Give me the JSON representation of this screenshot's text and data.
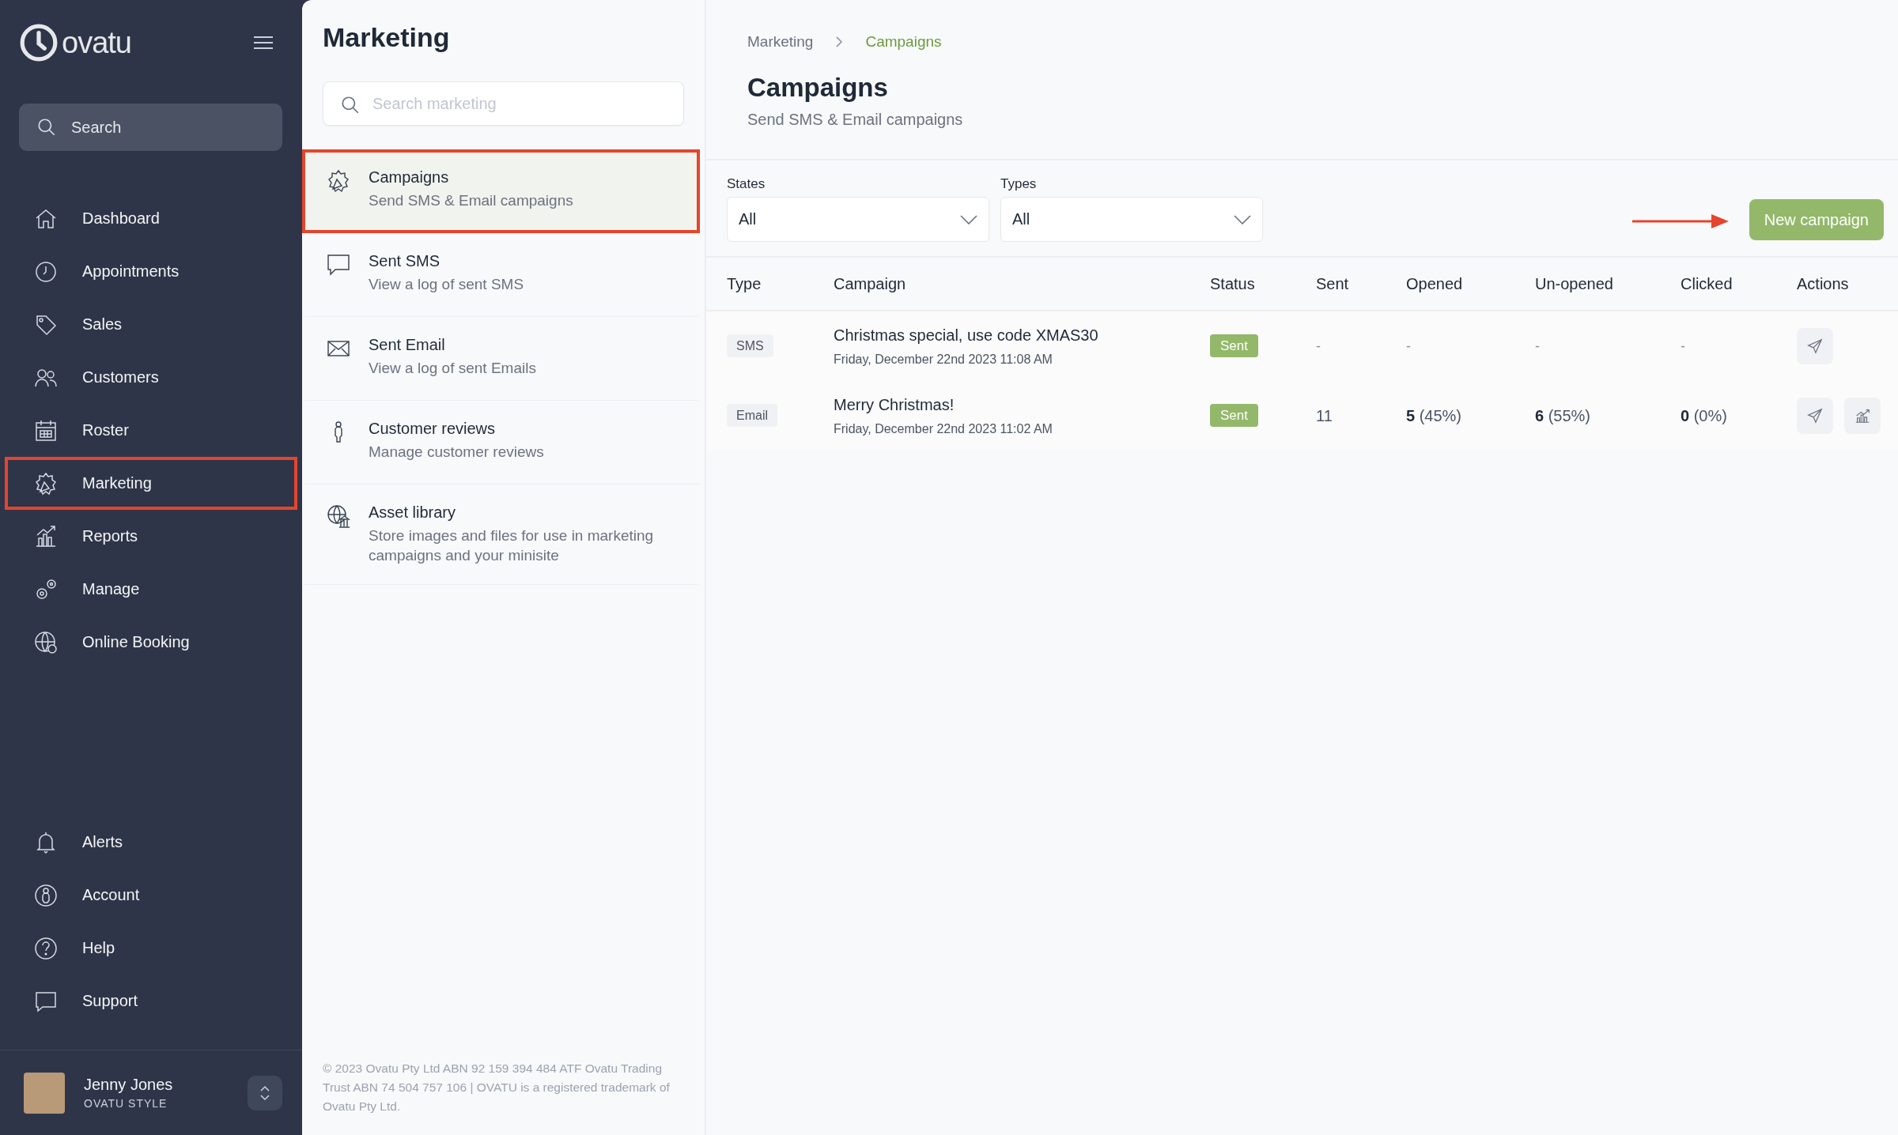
{
  "sidebar": {
    "logo": "ovatu",
    "search_placeholder": "Search",
    "nav_items": [
      {
        "label": "Dashboard",
        "highlighted": false
      },
      {
        "label": "Appointments",
        "highlighted": false
      },
      {
        "label": "Sales",
        "highlighted": false
      },
      {
        "label": "Customers",
        "highlighted": false
      },
      {
        "label": "Roster",
        "highlighted": false
      },
      {
        "label": "Marketing",
        "highlighted": true
      },
      {
        "label": "Reports",
        "highlighted": false
      },
      {
        "label": "Manage",
        "highlighted": false
      },
      {
        "label": "Online Booking",
        "highlighted": false
      }
    ],
    "bottom_items": [
      {
        "label": "Alerts"
      },
      {
        "label": "Account"
      },
      {
        "label": "Help"
      },
      {
        "label": "Support"
      }
    ],
    "user": {
      "name": "Jenny Jones",
      "org": "OVATU STYLE"
    }
  },
  "submenu": {
    "title": "Marketing",
    "search_placeholder": "Search marketing",
    "items": [
      {
        "title": "Campaigns",
        "subtitle": "Send SMS & Email campaigns",
        "selected": true,
        "highlighted": true
      },
      {
        "title": "Sent SMS",
        "subtitle": "View a log of sent SMS",
        "selected": false,
        "highlighted": false
      },
      {
        "title": "Sent Email",
        "subtitle": "View a log of sent Emails",
        "selected": false,
        "highlighted": false
      },
      {
        "title": "Customer reviews",
        "subtitle": "Manage customer reviews",
        "selected": false,
        "highlighted": false
      },
      {
        "title": "Asset library",
        "subtitle": "Store images and files for use in marketing campaigns and your minisite",
        "selected": false,
        "highlighted": false
      }
    ],
    "footer": "© 2023 Ovatu Pty Ltd ABN 92 159 394 484 ATF Ovatu Trading Trust ABN 74 504 757 106 | OVATU is a registered trademark of Ovatu Pty Ltd."
  },
  "main": {
    "breadcrumb": [
      {
        "label": "Marketing",
        "selected": false
      },
      {
        "label": "Campaigns",
        "selected": true
      }
    ],
    "title": "Campaigns",
    "subtitle": "Send SMS & Email campaigns",
    "filters": [
      {
        "label": "States",
        "value": "All"
      },
      {
        "label": "Types",
        "value": "All"
      }
    ],
    "new_button": {
      "label": "New campaign",
      "arrow": true
    },
    "table": {
      "columns": [
        "Type",
        "Campaign",
        "Status",
        "Sent",
        "Opened",
        "Un-opened",
        "Clicked",
        "Actions"
      ],
      "rows": [
        {
          "type": "SMS",
          "campaign": "Christmas special, use code XMAS30",
          "date": "Friday, December 22nd 2023 11:08 AM",
          "status": "Sent",
          "sent": "-",
          "opened": "-",
          "unopened": "-",
          "clicked": "-",
          "actions": [
            {
              "kind": "send"
            }
          ]
        },
        {
          "type": "Email",
          "campaign": "Merry Christmas!",
          "date": "Friday, December 22nd 2023 11:02 AM",
          "status": "Sent",
          "sent": "11",
          "opened": "**5** (45%)",
          "unopened": "**6** (55%)",
          "clicked": "**0** (0%)",
          "actions": [
            {
              "kind": "send"
            },
            {
              "kind": "stats"
            }
          ]
        }
      ]
    }
  }
}
